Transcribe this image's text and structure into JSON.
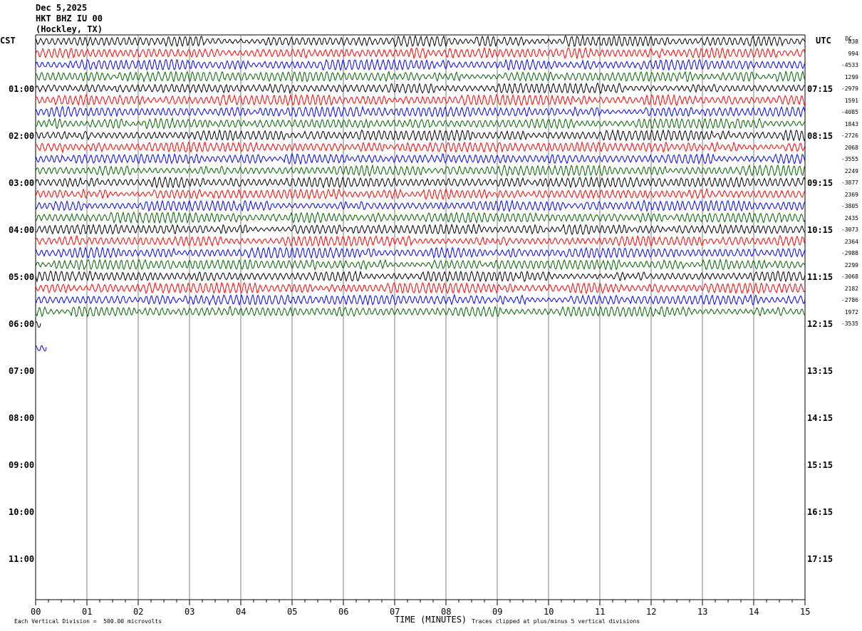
{
  "header": {
    "date": "Dec 5,2025",
    "station": "HKT BHZ IU 00",
    "location": "(Hockley, TX)"
  },
  "labels": {
    "left_tz": "CST",
    "right_tz": "UTC",
    "dc": "DC"
  },
  "footer": {
    "scale": "Each Vertical Division =  500.00 microvolts",
    "xlabel": "TIME (MINUTES)",
    "clip": "Traces clipped at plus/minus 5 vertical divisions"
  },
  "colors": {
    "trace_cycle": [
      "#000000",
      "#ff0000",
      "#0000ff",
      "#006400"
    ],
    "grid": "#7f7f7f"
  },
  "chart_data": {
    "type": "line",
    "title": "",
    "xlabel": "TIME (MINUTES)",
    "ylabel": "",
    "x_range": [
      0,
      15
    ],
    "x_ticks": [
      "00",
      "01",
      "02",
      "03",
      "04",
      "05",
      "06",
      "07",
      "08",
      "09",
      "10",
      "11",
      "12",
      "13",
      "14",
      "15"
    ],
    "grid": true,
    "cst_hours": [
      "01:00",
      "02:00",
      "03:00",
      "04:00",
      "05:00",
      "06:00",
      "07:00",
      "08:00",
      "09:00",
      "10:00",
      "11:00"
    ],
    "utc_hours": [
      "07:15",
      "08:15",
      "09:15",
      "10:15",
      "11:15",
      "12:15",
      "13:15",
      "14:15",
      "15:15",
      "16:15",
      "17:15"
    ],
    "dc_offsets": [
      "838",
      "994",
      "-4533",
      "1299",
      "-2979",
      "1591",
      "-4085",
      "1843",
      "-2726",
      "2068",
      "-3555",
      "2249",
      "-3877",
      "2369",
      "-3805",
      "2435",
      "-3073",
      "2364",
      "-2988",
      "2299",
      "-3068",
      "2182",
      "-2786",
      "1972",
      "-3535"
    ],
    "traces_full": 24,
    "partial_traces": [
      {
        "row": 24,
        "end_minute": 0.1
      },
      {
        "row": 26,
        "end_minute": 0.22
      }
    ]
  }
}
